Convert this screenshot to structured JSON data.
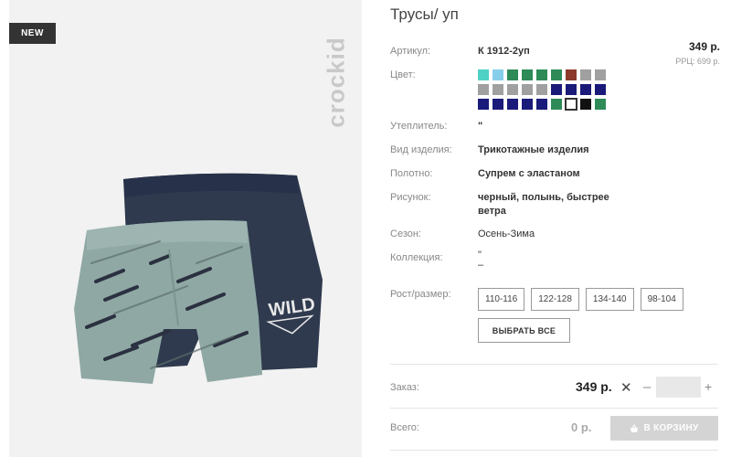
{
  "badge": "NEW",
  "brand": "crockid",
  "product": {
    "title": "Трусы/ уп",
    "price": "349 р.",
    "rrp": "РРЦ: 699 р.",
    "rows": {
      "article": {
        "label": "Артикул:",
        "value": "К 1912-2уп"
      },
      "color": {
        "label": "Цвет:"
      },
      "insulation": {
        "label": "Утеплитель:",
        "value": "\""
      },
      "type": {
        "label": "Вид изделия:",
        "value": "Трикотажные изделия"
      },
      "fabric": {
        "label": "Полотно:",
        "value": "Супрем с эластаном"
      },
      "pattern": {
        "label": "Рисунок:",
        "value": "черный, полынь, быстрее ветра"
      },
      "season": {
        "label": "Сезон:",
        "value": "Осень-Зима"
      },
      "collection": {
        "label": "Коллекция:",
        "value": "\"",
        "value2": "–"
      },
      "size": {
        "label": "Рост/размер:"
      }
    },
    "swatches": [
      "#4fd1c5",
      "#87ceeb",
      "#2e8b57",
      "#2e8b57",
      "#2e8b57",
      "#2e8b57",
      "#8b3a2b",
      "#a0a0a0",
      "#a0a0a0",
      "#a0a0a0",
      "#a0a0a0",
      "#a0a0a0",
      "#a0a0a0",
      "#a0a0a0",
      "#1a1a7a",
      "#1a1a7a",
      "#1a1a7a",
      "#1a1a7a",
      "#1a1a7a",
      "#1a1a7a",
      "#1a1a7a",
      "#1a1a7a",
      "#1a1a7a",
      "#2e8b57",
      "#ffffff",
      "#111111",
      "#2e8b57"
    ],
    "selected_swatch": 24,
    "sizes": [
      "110-116",
      "122-128",
      "134-140",
      "98-104"
    ],
    "select_all": "ВЫБРАТЬ ВСЕ"
  },
  "order": {
    "label": "Заказ:",
    "amount": "349 р.",
    "times": "✕",
    "minus": "–",
    "plus": "+",
    "quantity": ""
  },
  "total": {
    "label": "Всего:",
    "amount": "0 р.",
    "cart_button": "В КОРЗИНУ"
  }
}
